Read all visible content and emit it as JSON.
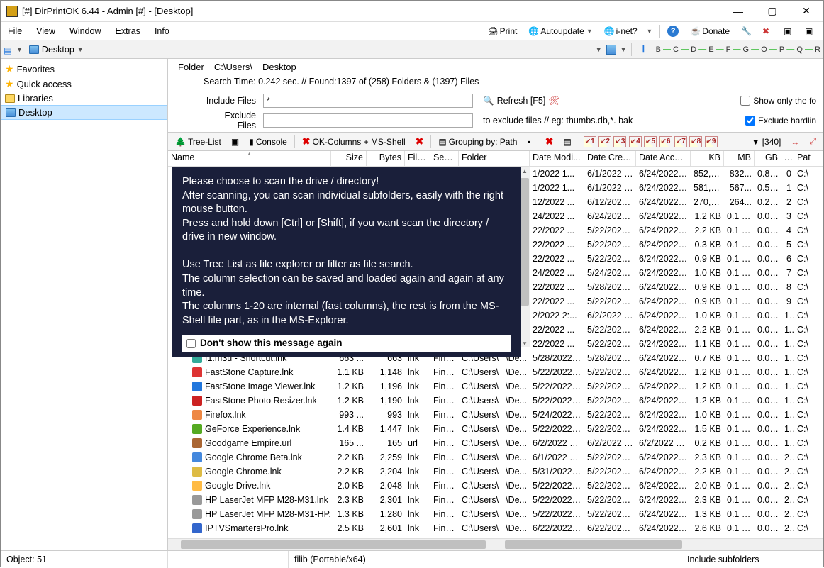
{
  "title": "[#] DirPrintOK 6.44 - Admin [#] - [Desktop]",
  "menu": [
    "File",
    "View",
    "Window",
    "Extras",
    "Info"
  ],
  "menuright": {
    "print": "Print",
    "auto": "Autoupdate",
    "inet": "i-net?",
    "donate": "Donate"
  },
  "addr": {
    "label": "Desktop"
  },
  "abc": [
    "B",
    "C",
    "D",
    "E",
    "F",
    "G",
    "O",
    "P",
    "Q",
    "R"
  ],
  "nav": [
    {
      "label": "Favorites",
      "icon": "star"
    },
    {
      "label": "Quick access",
      "icon": "star"
    },
    {
      "label": "Libraries",
      "icon": "folder"
    },
    {
      "label": "Desktop",
      "icon": "bluefolder",
      "sel": true
    }
  ],
  "path": {
    "a": "Folder",
    "b": "C:\\Users\\",
    "c": "Desktop"
  },
  "searchinfo": "Search Time: 0.242 sec. //  Found:1397 of (258) Folders & (1397) Files",
  "include": {
    "label": "Include Files",
    "value": "*"
  },
  "exclude": {
    "label": "Exclude Files",
    "value": "",
    "hint": "to exclude files // eg: thumbs.db,*. bak"
  },
  "refresh": "Refresh [F5]",
  "showonly": "Show only the fo",
  "excludehard": "Exclude hardlin",
  "tb2": {
    "tree": "Tree-List",
    "console": "Console",
    "okcols": "OK-Columns + MS-Shell",
    "group": "Grouping by: Path",
    "count": "[340]"
  },
  "cols": [
    "Name",
    "Size",
    "Bytes",
    "File e...",
    "Sea...",
    "Folder",
    "Date Modi...",
    "Date Creat...",
    "Date Acces...",
    "KB",
    "MB",
    "GB",
    "...",
    "Pat"
  ],
  "overlay": {
    "lines": [
      "Please choose to scan the drive / directory!",
      "After scanning, you can scan individual subfolders, easily with the right mouse button.",
      "Press and hold down [Ctrl] or [Shift], if you want scan the directory / drive in new window.",
      "",
      "Use Tree List as file explorer or filter as file search.",
      "The column selection can be saved and loaded again and again at any time.",
      "The columns 1-20 are internal (fast columns), the rest is from the MS-Shell file part, as in the MS-Explorer."
    ],
    "dont": "Don't show  this message again"
  },
  "rows": [
    {
      "dm": "1/2022 1...",
      "dc": "6/1/2022 1...",
      "da": "6/24/2022 ...",
      "kb": "852,43...",
      "mb": "832...",
      "gb": "0.81...",
      "n": "0",
      "pat": "C:\\"
    },
    {
      "dm": "1/2022 1...",
      "dc": "6/1/2022 1...",
      "da": "6/24/2022 ...",
      "kb": "581,39...",
      "mb": "567...",
      "gb": "0.55...",
      "n": "1",
      "pat": "C:\\"
    },
    {
      "dm": "12/2022 ...",
      "dc": "6/12/2022 ...",
      "da": "6/24/2022 ...",
      "kb": "270,98...",
      "mb": "264...",
      "gb": "0.25...",
      "n": "2",
      "pat": "C:\\"
    },
    {
      "dm": "24/2022 ...",
      "dc": "6/24/2022 ...",
      "da": "6/24/2022 ...",
      "kb": "1.2 KB",
      "mb": "0.1 MB",
      "gb": "0.00...",
      "n": "3",
      "pat": "C:\\"
    },
    {
      "dm": "22/2022 ...",
      "dc": "5/22/2022 ...",
      "da": "6/24/2022 ...",
      "kb": "2.2 KB",
      "mb": "0.1 MB",
      "gb": "0.00...",
      "n": "4",
      "pat": "C:\\"
    },
    {
      "dm": "22/2022 ...",
      "dc": "5/22/2022 ...",
      "da": "6/24/2022 ...",
      "kb": "0.3 KB",
      "mb": "0.1 MB",
      "gb": "0.00...",
      "n": "5",
      "pat": "C:\\"
    },
    {
      "dm": "22/2022 ...",
      "dc": "5/22/2022 ...",
      "da": "6/24/2022 ...",
      "kb": "0.9 KB",
      "mb": "0.1 MB",
      "gb": "0.00...",
      "n": "6",
      "pat": "C:\\"
    },
    {
      "dm": "24/2022 ...",
      "dc": "5/24/2022 ...",
      "da": "6/24/2022 ...",
      "kb": "1.0 KB",
      "mb": "0.1 MB",
      "gb": "0.00...",
      "n": "7",
      "pat": "C:\\"
    },
    {
      "dm": "22/2022 ...",
      "dc": "5/28/2022 ...",
      "da": "6/24/2022 ...",
      "kb": "0.9 KB",
      "mb": "0.1 MB",
      "gb": "0.00...",
      "n": "8",
      "pat": "C:\\"
    },
    {
      "dm": "22/2022 ...",
      "dc": "5/22/2022 ...",
      "da": "6/24/2022 ...",
      "kb": "0.9 KB",
      "mb": "0.1 MB",
      "gb": "0.00...",
      "n": "9",
      "pat": "C:\\"
    },
    {
      "dm": "2/2022 2:...",
      "dc": "6/2/2022 2:...",
      "da": "6/24/2022 ...",
      "kb": "1.0 KB",
      "mb": "0.1 MB",
      "gb": "0.00...",
      "n": "10",
      "pat": "C:\\"
    },
    {
      "dm": "22/2022 ...",
      "dc": "5/22/2022 ...",
      "da": "6/24/2022 ...",
      "kb": "2.2 KB",
      "mb": "0.1 MB",
      "gb": "0.00...",
      "n": "11",
      "pat": "C:\\"
    },
    {
      "dm": "22/2022 ...",
      "dc": "5/22/2022 ...",
      "da": "6/24/2022 ...",
      "kb": "1.1 KB",
      "mb": "0.1 MB",
      "gb": "0.00...",
      "n": "12",
      "pat": "C:\\"
    }
  ],
  "rows2": [
    {
      "name": "f1.m3u - Shortcut.lnk",
      "ic": "#3a9",
      "size": "663 ...",
      "bytes": "663",
      "fe": "lnk",
      "sea": "Find...",
      "fold": "C:\\Users\\",
      "de": "\\De...",
      "dm": "5/28/2022 ...",
      "dc": "5/28/2022 ...",
      "da": "6/24/2022 ...",
      "kb": "0.7 KB",
      "mb": "0.1 MB",
      "gb": "0.00...",
      "n": "13",
      "pat": "C:\\"
    },
    {
      "name": "FastStone Capture.lnk",
      "ic": "#d33",
      "size": "1.1 KB",
      "bytes": "1,148",
      "fe": "lnk",
      "sea": "Find...",
      "fold": "C:\\Users\\",
      "de": "\\De...",
      "dm": "5/22/2022 ...",
      "dc": "5/22/2022 ...",
      "da": "6/24/2022 ...",
      "kb": "1.2 KB",
      "mb": "0.1 MB",
      "gb": "0.00...",
      "n": "14",
      "pat": "C:\\"
    },
    {
      "name": "FastStone Image Viewer.lnk",
      "ic": "#27d",
      "size": "1.2 KB",
      "bytes": "1,196",
      "fe": "lnk",
      "sea": "Find...",
      "fold": "C:\\Users\\",
      "de": "\\De...",
      "dm": "5/22/2022 ...",
      "dc": "5/22/2022 ...",
      "da": "6/24/2022 ...",
      "kb": "1.2 KB",
      "mb": "0.1 MB",
      "gb": "0.00...",
      "n": "15",
      "pat": "C:\\"
    },
    {
      "name": "FastStone Photo Resizer.lnk",
      "ic": "#c22",
      "size": "1.2 KB",
      "bytes": "1,190",
      "fe": "lnk",
      "sea": "Find...",
      "fold": "C:\\Users\\",
      "de": "\\De...",
      "dm": "5/22/2022 ...",
      "dc": "5/22/2022 ...",
      "da": "6/24/2022 ...",
      "kb": "1.2 KB",
      "mb": "0.1 MB",
      "gb": "0.00...",
      "n": "16",
      "pat": "C:\\"
    },
    {
      "name": "Firefox.lnk",
      "ic": "#e84",
      "size": "993 ...",
      "bytes": "993",
      "fe": "lnk",
      "sea": "Find...",
      "fold": "C:\\Users\\",
      "de": "\\De...",
      "dm": "5/24/2022 ...",
      "dc": "5/22/2022 ...",
      "da": "6/24/2022 ...",
      "kb": "1.0 KB",
      "mb": "0.1 MB",
      "gb": "0.00...",
      "n": "17",
      "pat": "C:\\"
    },
    {
      "name": "GeForce Experience.lnk",
      "ic": "#5a2",
      "size": "1.4 KB",
      "bytes": "1,447",
      "fe": "lnk",
      "sea": "Find...",
      "fold": "C:\\Users\\",
      "de": "\\De...",
      "dm": "5/22/2022 ...",
      "dc": "5/22/2022 ...",
      "da": "6/24/2022 ...",
      "kb": "1.5 KB",
      "mb": "0.1 MB",
      "gb": "0.00...",
      "n": "18",
      "pat": "C:\\"
    },
    {
      "name": "Goodgame Empire.url",
      "ic": "#a63",
      "size": "165 ...",
      "bytes": "165",
      "fe": "url",
      "sea": "Find...",
      "fold": "C:\\Users\\",
      "de": "\\De...",
      "dm": "6/2/2022 2:...",
      "dc": "6/2/2022 2:...",
      "da": "6/2/2022 2:...",
      "kb": "0.2 KB",
      "mb": "0.1 MB",
      "gb": "0.00...",
      "n": "19",
      "pat": "C:\\"
    },
    {
      "name": "Google Chrome Beta.lnk",
      "ic": "#48d",
      "size": "2.2 KB",
      "bytes": "2,259",
      "fe": "lnk",
      "sea": "Find...",
      "fold": "C:\\Users\\",
      "de": "\\De...",
      "dm": "6/1/2022 8:...",
      "dc": "5/22/2022 ...",
      "da": "6/24/2022 ...",
      "kb": "2.3 KB",
      "mb": "0.1 MB",
      "gb": "0.00...",
      "n": "20",
      "pat": "C:\\"
    },
    {
      "name": "Google Chrome.lnk",
      "ic": "#db4",
      "size": "2.2 KB",
      "bytes": "2,204",
      "fe": "lnk",
      "sea": "Find...",
      "fold": "C:\\Users\\",
      "de": "\\De...",
      "dm": "5/31/2022 ...",
      "dc": "5/22/2022 ...",
      "da": "6/24/2022 ...",
      "kb": "2.2 KB",
      "mb": "0.1 MB",
      "gb": "0.00...",
      "n": "21",
      "pat": "C:\\"
    },
    {
      "name": "Google Drive.lnk",
      "ic": "#fb4",
      "size": "2.0 KB",
      "bytes": "2,048",
      "fe": "lnk",
      "sea": "Find...",
      "fold": "C:\\Users\\",
      "de": "\\De...",
      "dm": "5/22/2022 ...",
      "dc": "5/22/2022 ...",
      "da": "6/24/2022 ...",
      "kb": "2.0 KB",
      "mb": "0.1 MB",
      "gb": "0.00...",
      "n": "22",
      "pat": "C:\\"
    },
    {
      "name": "HP LaserJet MFP M28-M31.lnk",
      "ic": "#999",
      "size": "2.3 KB",
      "bytes": "2,301",
      "fe": "lnk",
      "sea": "Find...",
      "fold": "C:\\Users\\",
      "de": "\\De...",
      "dm": "5/22/2022 ...",
      "dc": "5/22/2022 ...",
      "da": "6/24/2022 ...",
      "kb": "2.3 KB",
      "mb": "0.1 MB",
      "gb": "0.00...",
      "n": "23",
      "pat": "C:\\"
    },
    {
      "name": "HP LaserJet MFP M28-M31-HP...",
      "ic": "#999",
      "size": "1.3 KB",
      "bytes": "1,280",
      "fe": "lnk",
      "sea": "Find...",
      "fold": "C:\\Users\\",
      "de": "\\De...",
      "dm": "5/22/2022 ...",
      "dc": "5/22/2022 ...",
      "da": "6/24/2022 ...",
      "kb": "1.3 KB",
      "mb": "0.1 MB",
      "gb": "0.00...",
      "n": "24",
      "pat": "C:\\"
    },
    {
      "name": "IPTVSmartersPro.lnk",
      "ic": "#36c",
      "size": "2.5 KB",
      "bytes": "2,601",
      "fe": "lnk",
      "sea": "Find...",
      "fold": "C:\\Users\\",
      "de": "\\De...",
      "dm": "6/22/2022 ...",
      "dc": "6/22/2022 ...",
      "da": "6/24/2022 ...",
      "kb": "2.6 KB",
      "mb": "0.1 MB",
      "gb": "0.00...",
      "n": "25",
      "pat": "C:\\"
    }
  ],
  "status": {
    "obj": "Object: 51",
    "mid": "filib (Portable/x64)",
    "inc": "Include subfolders"
  }
}
